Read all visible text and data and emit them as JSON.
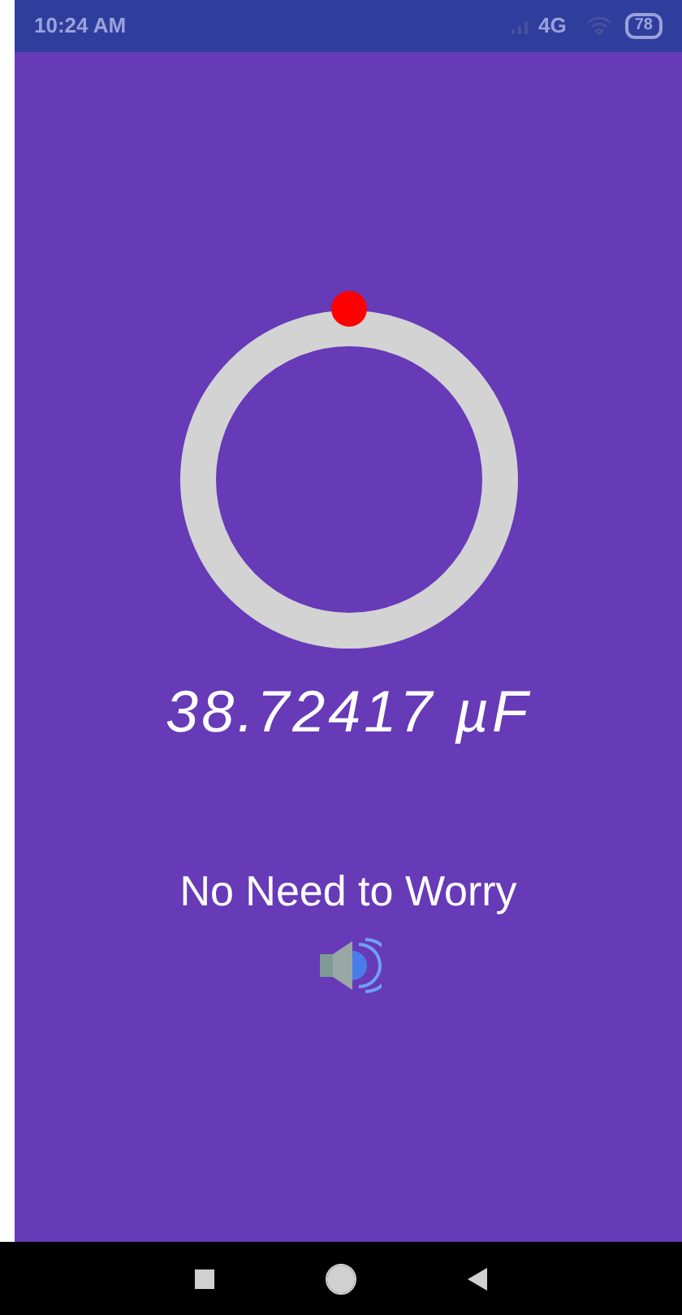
{
  "status_bar": {
    "time": "10:24 AM",
    "network": "4G",
    "battery": "78"
  },
  "meter": {
    "reading": "38.72417 µF"
  },
  "message": "No Need to Worry",
  "sound": {
    "on": true
  }
}
